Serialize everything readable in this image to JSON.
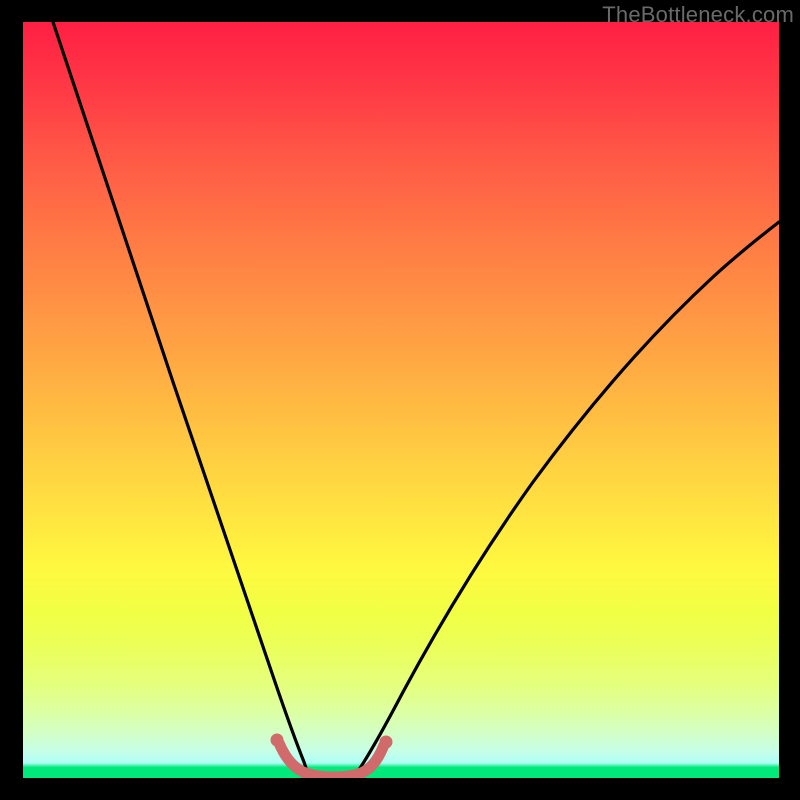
{
  "watermark": "TheBottleneck.com",
  "chart_data": {
    "type": "line",
    "title": "",
    "xlabel": "",
    "ylabel": "",
    "xlim": [
      0,
      100
    ],
    "ylim": [
      0,
      100
    ],
    "series": [
      {
        "name": "left-curve",
        "x": [
          4,
          8,
          12,
          16,
          20,
          24,
          28,
          31,
          33.5,
          35.5,
          37
        ],
        "y": [
          100,
          88,
          75,
          62,
          49,
          36,
          23,
          12,
          5,
          1,
          0
        ]
      },
      {
        "name": "right-curve",
        "x": [
          44,
          46,
          49,
          53,
          58,
          64,
          71,
          79,
          88,
          100
        ],
        "y": [
          0,
          1,
          5,
          11,
          19,
          28,
          38,
          48,
          58,
          70
        ]
      },
      {
        "name": "bottom-highlight",
        "x": [
          33.5,
          35,
          37,
          39,
          41,
          43,
          44.5,
          46,
          47.5
        ],
        "y": [
          4.5,
          1.5,
          0.3,
          0,
          0,
          0.2,
          0.8,
          2.2,
          5
        ]
      }
    ],
    "colors": {
      "curve": "#000000",
      "highlight": "#d16a6a"
    }
  }
}
